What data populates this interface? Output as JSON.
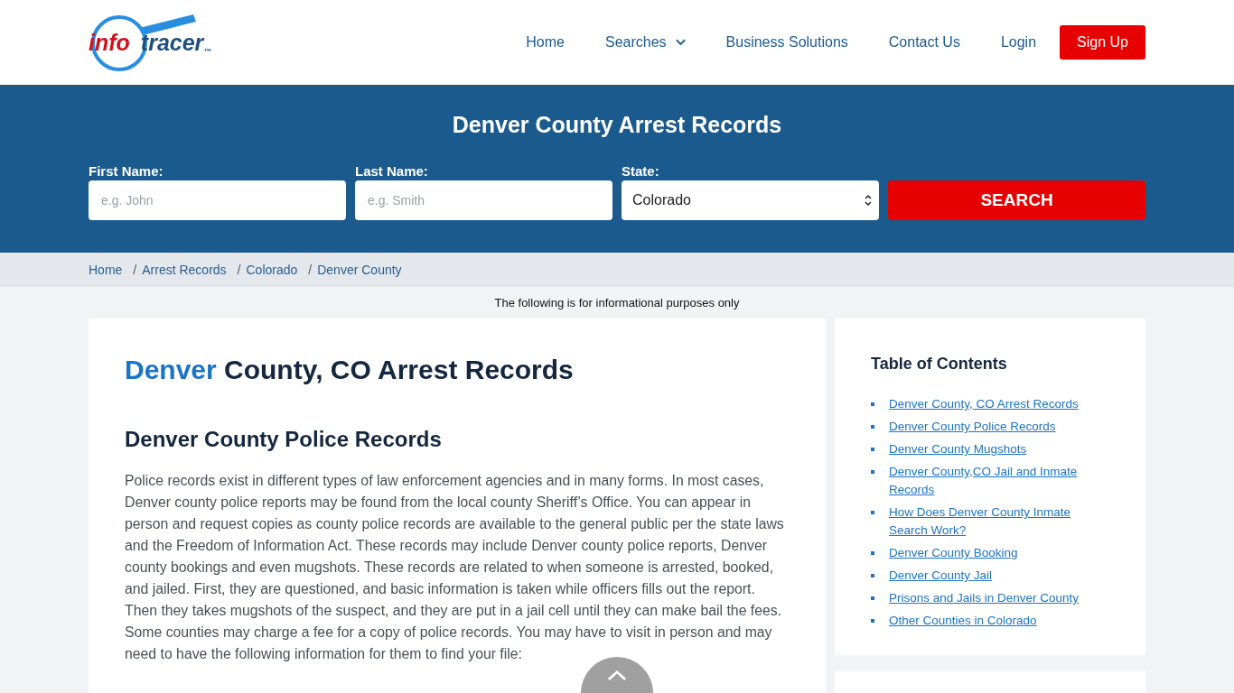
{
  "logo": {
    "part_1": "info",
    "part_2": "tracer",
    "mark": "™"
  },
  "nav": [
    {
      "label": "Home",
      "kind": "link"
    },
    {
      "label": "Searches",
      "kind": "dropdown"
    },
    {
      "label": "Business Solutions",
      "kind": "link"
    },
    {
      "label": "Contact Us",
      "kind": "link"
    },
    {
      "label": "Login",
      "kind": "link"
    },
    {
      "label": "Sign Up",
      "kind": "button"
    }
  ],
  "search": {
    "title": "Denver County Arrest Records",
    "fields": [
      {
        "label": "First Name:",
        "placeholder": "e.g. John",
        "kind": "text"
      },
      {
        "label": "Last Name:",
        "placeholder": "e.g. Smith",
        "kind": "text"
      },
      {
        "label": "State:",
        "value": "Colorado",
        "kind": "select"
      }
    ],
    "button": "SEARCH"
  },
  "breadcrumb": {
    "separator": "/",
    "items": [
      "Home",
      "Arrest Records",
      "Colorado",
      "Denver County"
    ]
  },
  "notice": "The following is for informational purposes only",
  "article": {
    "title_highlight": "Denver",
    "title_rest": "County, CO Arrest Records",
    "subheading": "Denver County Police Records",
    "paragraph": "Police records exist in different types of law enforcement agencies and in many forms. In most cases, Denver county police reports may be found from the local county Sheriff’s Office. You can appear in person and request copies as county police records are available to the general public per the state laws and the Freedom of Information Act. These records may include Denver county police reports, Denver county bookings and even mugshots. These records are related to when someone is arrested, booked, and jailed. First, they are questioned, and basic information is taken while officers fills out the report. Then they takes mugshots of the suspect, and they are put in a jail cell until they can make bail the fees. Some counties may charge a fee for a copy of police records. You may have to visit in person and may need to have the following information for them to find your file:"
  },
  "toc": {
    "title": "Table of Contents",
    "items": [
      "Denver County, CO Arrest Records",
      "Denver County Police Records",
      "Denver County Mugshots",
      "Denver County,CO Jail and Inmate Records",
      "How Does Denver County Inmate Search Work?",
      "Denver County Booking",
      "Denver County Jail",
      "Prisons and Jails in Denver County",
      "Other Counties in Colorado"
    ]
  }
}
